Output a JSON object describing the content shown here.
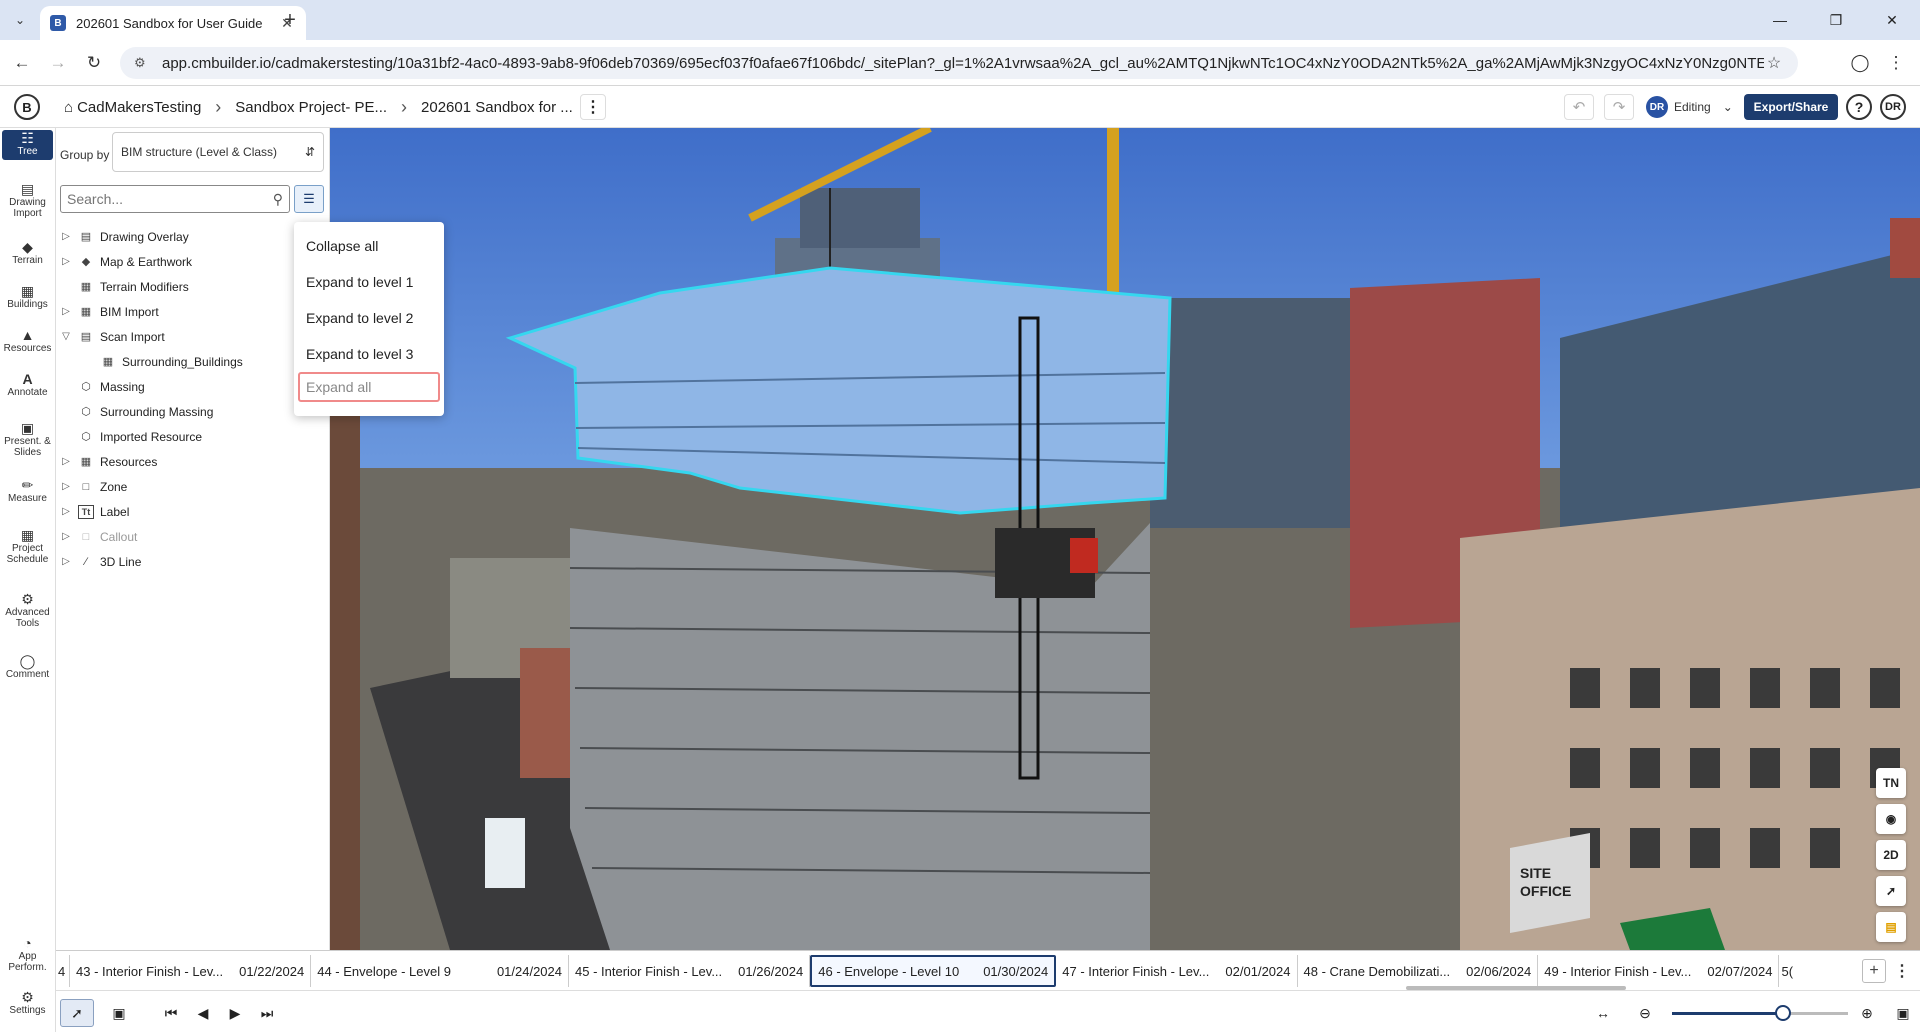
{
  "browser": {
    "tab_title": "202601 Sandbox for User Guide",
    "favicon_letter": "B",
    "url": "app.cmbuilder.io/cadmakerstesting/10a31bf2-4ac0-4893-9ab8-9f06deb70369/695ecf037f0afae67f106bdc/_sitePlan?_gl=1%2A1vrwsaa%2A_gcl_au%2AMTQ1NjkwNTc1OC4xNzY0ODA2NTk5%2A_ga%2AMjAwMjk3NzgyOC4xNzY0Nzg0NTEz%2A_ga_BCY4GYDNV2%..."
  },
  "header": {
    "logo_letter": "B",
    "breadcrumbs": [
      "CadMakersTesting",
      "Sandbox Project- PE...",
      "202601 Sandbox for ..."
    ],
    "editing_label": "Editing",
    "avatar_initials": "DR",
    "export_label": "Export/Share",
    "help_label": "?",
    "user_initials": "DR"
  },
  "rail": [
    {
      "icon": "tree-icon",
      "label": "Tree"
    },
    {
      "icon": "drawing-import-icon",
      "label": "Drawing Import"
    },
    {
      "icon": "terrain-icon",
      "label": "Terrain"
    },
    {
      "icon": "buildings-icon",
      "label": "Buildings"
    },
    {
      "icon": "resources-icon",
      "label": "Resources"
    },
    {
      "icon": "annotate-icon",
      "label": "Annotate"
    },
    {
      "icon": "present-slides-icon",
      "label": "Present. & Slides"
    },
    {
      "icon": "measure-icon",
      "label": "Measure"
    },
    {
      "icon": "project-schedule-icon",
      "label": "Project Schedule"
    },
    {
      "icon": "advanced-tools-icon",
      "label": "Advanced Tools"
    },
    {
      "icon": "comment-icon",
      "label": "Comment"
    },
    {
      "icon": "app-performance-icon",
      "label": "App Perform."
    },
    {
      "icon": "settings-icon",
      "label": "Settings"
    }
  ],
  "panel": {
    "groupby_label": "Group by",
    "groupby_value": "BIM structure (Level & Class)",
    "search_placeholder": "Search...",
    "tree": [
      {
        "label": "Drawing Overlay",
        "expandable": true
      },
      {
        "label": "Map & Earthwork",
        "expandable": true
      },
      {
        "label": "Terrain Modifiers",
        "expandable": false
      },
      {
        "label": "BIM Import",
        "expandable": true
      },
      {
        "label": "Scan Import",
        "expandable": true,
        "expanded": true
      },
      {
        "label": "Surrounding_Buildings",
        "expandable": false,
        "child": true
      },
      {
        "label": "Massing",
        "expandable": false
      },
      {
        "label": "Surrounding Massing",
        "expandable": false
      },
      {
        "label": "Imported Resource",
        "expandable": false
      },
      {
        "label": "Resources",
        "expandable": true
      },
      {
        "label": "Zone",
        "expandable": true
      },
      {
        "label": "Label",
        "expandable": true
      },
      {
        "label": "Callout",
        "expandable": true,
        "disabled": true
      },
      {
        "label": "3D Line",
        "expandable": true
      }
    ]
  },
  "dropdown": {
    "items": [
      "Collapse all",
      "Expand to level 1",
      "Expand to level 2",
      "Expand to level 3",
      "Expand all"
    ]
  },
  "viewport_tools": [
    "TN",
    "",
    "2D",
    "",
    ""
  ],
  "timeline": {
    "items": [
      {
        "label": "4",
        "date": ""
      },
      {
        "label": "43 - Interior Finish - Lev...",
        "date": "01/22/2024"
      },
      {
        "label": "44 - Envelope - Level 9",
        "date": "01/24/2024"
      },
      {
        "label": "45 - Interior Finish - Lev...",
        "date": "01/26/2024"
      },
      {
        "label": "46 - Envelope - Level 10",
        "date": "01/30/2024",
        "active": true
      },
      {
        "label": "47 - Interior Finish - Lev...",
        "date": "02/01/2024"
      },
      {
        "label": "48 - Crane Demobilizati...",
        "date": "02/06/2024"
      },
      {
        "label": "49 - Interior Finish - Lev...",
        "date": "02/07/2024"
      },
      {
        "label": "5(",
        "date": ""
      }
    ]
  },
  "zoom": {
    "level_fraction": 0.63
  },
  "colors": {
    "brand": "#1d3c6e",
    "selection": "#35d7ef",
    "sky": "#3f6ec9"
  }
}
